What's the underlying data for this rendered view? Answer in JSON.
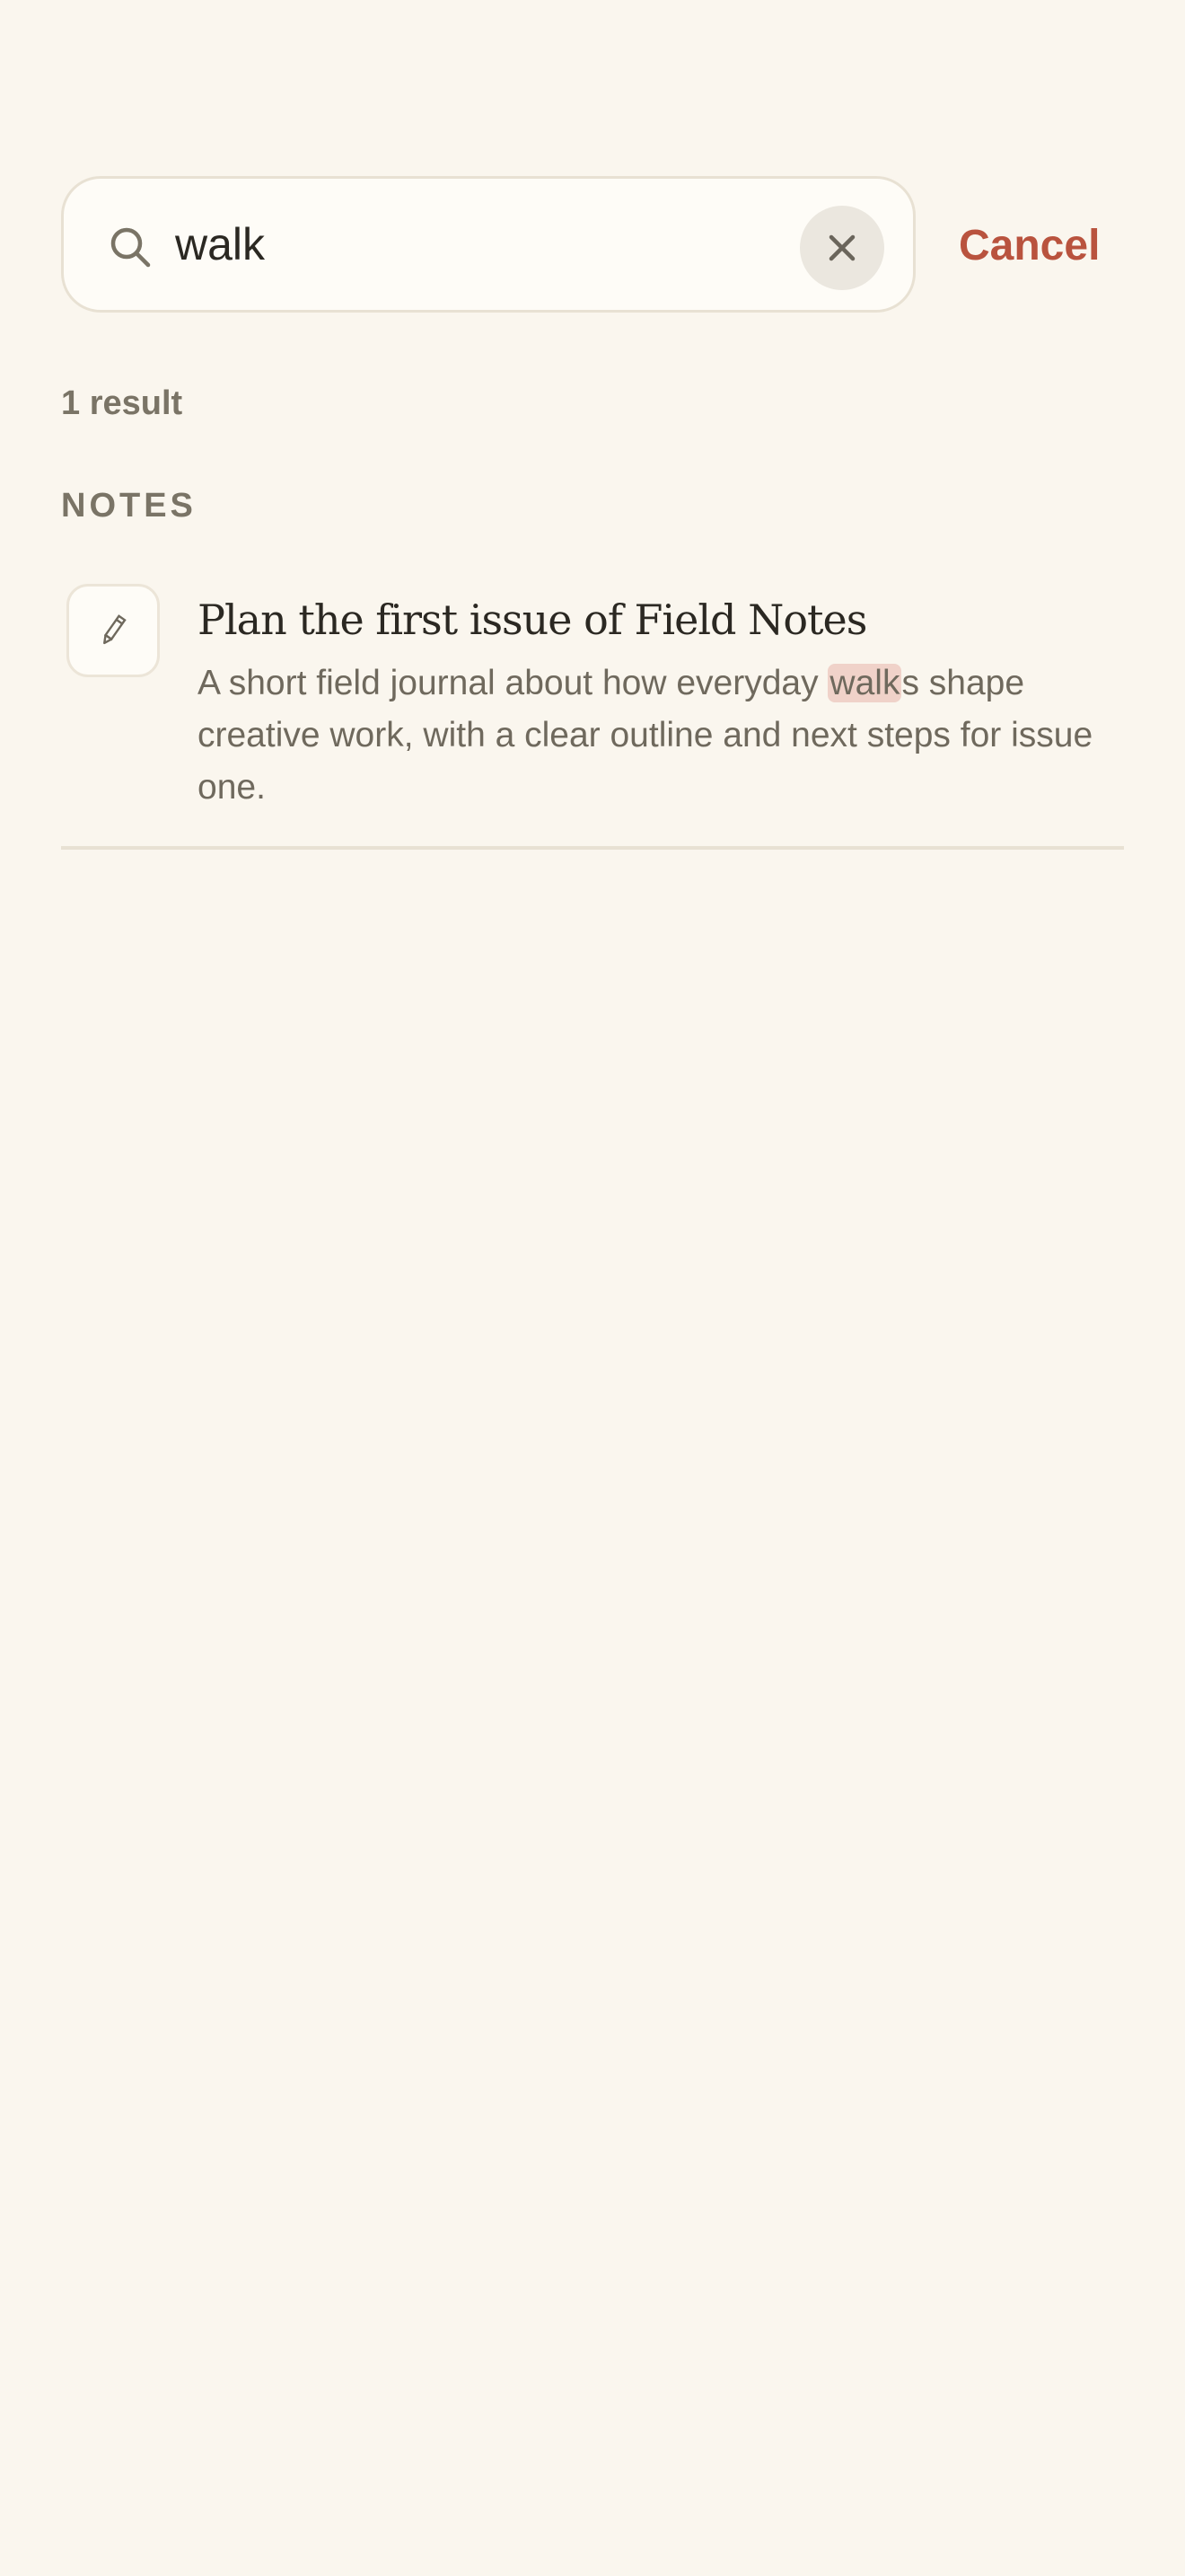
{
  "search": {
    "value": "walk",
    "cancel_label": "Cancel"
  },
  "results": {
    "count_label": "1 result",
    "section_label": "NOTES"
  },
  "notes": [
    {
      "icon": "pencil-icon",
      "title": "Plan the first issue of Field Notes",
      "snippet_before": "A short field journal about how everyday ",
      "snippet_match": "walk",
      "snippet_after": "s shape creative work, with a clear outline and next steps for issue one."
    }
  ],
  "colors": {
    "background": "#faf6ee",
    "accent": "#b9533e",
    "highlight": "#f0d2c9",
    "muted_text": "#7a7466"
  }
}
